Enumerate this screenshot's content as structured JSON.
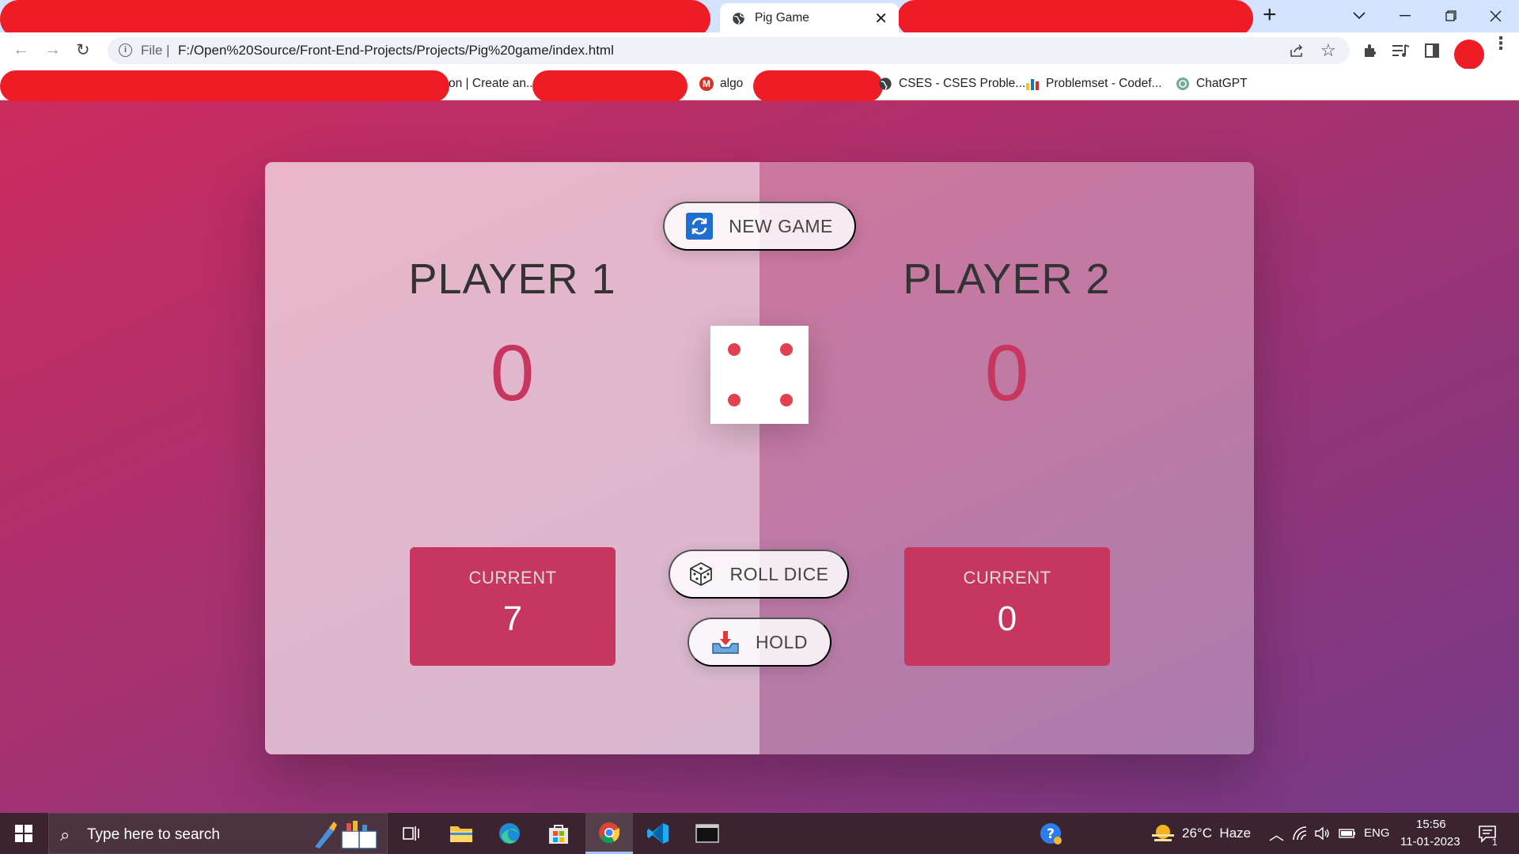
{
  "browser": {
    "tab_title": "Pig Game",
    "tab_close": "✕",
    "new_tab": "+",
    "url_scheme": "File |",
    "url": "F:/Open%20Source/Front-End-Projects/Projects/Pig%20game/index.html",
    "bookmarks": [
      {
        "label": "on | Create an..."
      },
      {
        "label": "algo",
        "badge": "M"
      },
      {
        "label": "CSES - CSES Proble..."
      },
      {
        "label": "Problemset - Codef..."
      },
      {
        "label": "ChatGPT"
      }
    ]
  },
  "game": {
    "new_game_label": "NEW GAME",
    "roll_dice_label": "ROLL DICE",
    "hold_label": "HOLD",
    "dice_value": 4,
    "player1": {
      "name": "PLAYER 1",
      "score": "0",
      "current_label": "CURRENT",
      "current": "7"
    },
    "player2": {
      "name": "PLAYER 2",
      "score": "0",
      "current_label": "CURRENT",
      "current": "0"
    }
  },
  "taskbar": {
    "search_placeholder": "Type here to search",
    "weather": "26°C  Haze",
    "language": "ENG",
    "time": "15:56",
    "date": "11-01-2023",
    "notification_count": "1"
  },
  "colors": {
    "accent": "#c7365f",
    "dice_pip": "#e0404f",
    "bg_from": "#cc2b5e",
    "bg_to": "#753a88"
  }
}
